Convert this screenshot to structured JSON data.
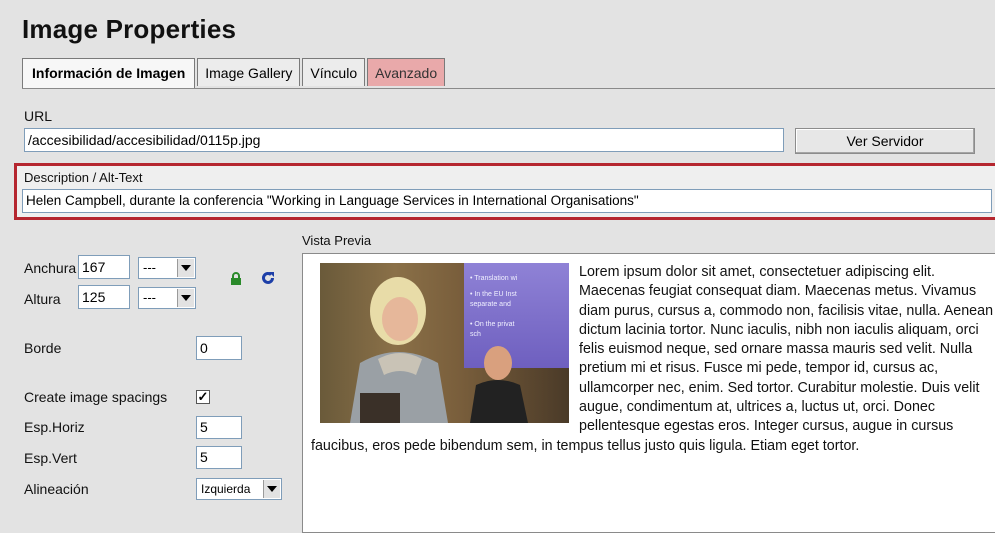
{
  "dialog": {
    "title": "Image Properties"
  },
  "tabs": [
    {
      "label": "Información de Imagen",
      "active": true
    },
    {
      "label": "Image Gallery",
      "active": false
    },
    {
      "label": "Vínculo",
      "active": false
    },
    {
      "label": "Avanzado",
      "active": false
    }
  ],
  "url": {
    "label": "URL",
    "value": "/accesibilidad/accesibilidad/0115p.jpg",
    "browse_button": "Ver Servidor"
  },
  "description": {
    "label": "Description / Alt-Text",
    "value": "Helen Campbell, durante la conferencia \"Working in Language Services in International Organisations\""
  },
  "dimensions": {
    "width_label": "Anchura",
    "width_value": "167",
    "width_unit": "---",
    "height_label": "Altura",
    "height_value": "125",
    "height_unit": "---"
  },
  "border": {
    "label": "Borde",
    "value": "0"
  },
  "spacing": {
    "create_label": "Create image spacings",
    "create_checked": true,
    "hspace_label": "Esp.Horiz",
    "hspace_value": "5",
    "vspace_label": "Esp.Vert",
    "vspace_value": "5"
  },
  "alignment": {
    "label": "Alineación",
    "value": "Izquierda"
  },
  "preview": {
    "label": "Vista Previa",
    "slide_bullets": [
      "• Translation wi",
      "• In the EU Inst",
      "  separate and",
      "• On the privat",
      "  sch"
    ],
    "text": "Lorem ipsum dolor sit amet, consectetuer adipiscing elit. Maecenas feugiat consequat diam. Maecenas metus. Vivamus diam purus, cursus a, commodo non, facilisis vitae, nulla. Aenean dictum lacinia tortor. Nunc iaculis, nibh non iaculis aliquam, orci felis euismod neque, sed ornare massa mauris sed velit. Nulla pretium mi et risus. Fusce mi pede, tempor id, cursus ac, ullamcorper nec, enim. Sed tortor. Curabitur molestie. Duis velit augue, condimentum at, ultrices a, luctus ut, orci. Donec pellentesque egestas eros. Integer cursus, augue in cursus faucibus, eros pede bibendum sem, in tempus tellus justo quis ligula. Etiam eget tortor."
  },
  "colors": {
    "accent_border": "#b5262f",
    "advanced_tab": "#e9a9aa",
    "lock_icon": "#2a8a2a",
    "reset_icon": "#1d3fa8"
  },
  "icons": [
    "lock-icon",
    "reset-size-icon",
    "dropdown-arrow-icon",
    "checkmark-icon"
  ]
}
